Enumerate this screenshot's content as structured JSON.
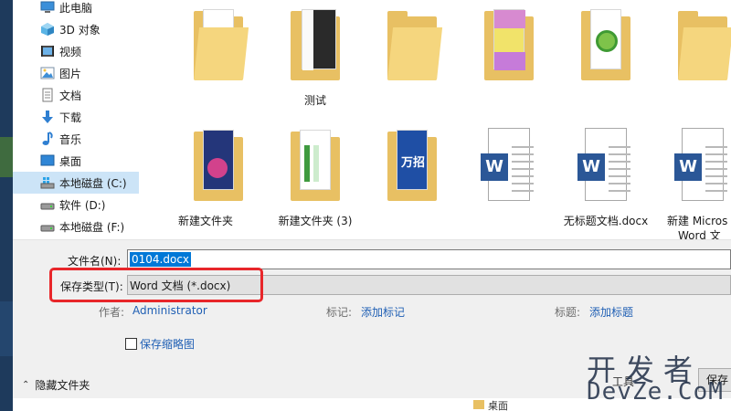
{
  "nav": {
    "items": [
      {
        "label": "此电脑",
        "icon": "computer-icon"
      },
      {
        "label": "3D 对象",
        "icon": "cube-3d-icon"
      },
      {
        "label": "视频",
        "icon": "video-icon"
      },
      {
        "label": "图片",
        "icon": "picture-icon"
      },
      {
        "label": "文档",
        "icon": "document-icon"
      },
      {
        "label": "下载",
        "icon": "download-arrow-icon"
      },
      {
        "label": "音乐",
        "icon": "music-note-icon"
      },
      {
        "label": "桌面",
        "icon": "desktop-icon"
      },
      {
        "label": "本地磁盘 (C:)",
        "icon": "windows-drive-icon",
        "selected": true
      },
      {
        "label": "软件 (D:)",
        "icon": "drive-icon"
      },
      {
        "label": "本地磁盘 (F:)",
        "icon": "drive-icon"
      }
    ]
  },
  "files": {
    "items": [
      {
        "name": "",
        "kind": "folder",
        "thumb": "code"
      },
      {
        "name": "测试",
        "kind": "folder",
        "thumb": "dark"
      },
      {
        "name": "",
        "kind": "folder",
        "thumb": "plain"
      },
      {
        "name": "",
        "kind": "folder",
        "thumb": "yellow-doc"
      },
      {
        "name": "",
        "kind": "folder",
        "thumb": "green-logo"
      },
      {
        "name": "",
        "kind": "folder",
        "thumb": "plain"
      },
      {
        "name": "新建文件夹",
        "kind": "folder",
        "thumb": "blue-book"
      },
      {
        "name": "新建文件夹 (3)",
        "kind": "folder",
        "thumb": "sheet"
      },
      {
        "name": "",
        "kind": "folder",
        "thumb": "blue-poster"
      },
      {
        "name": "",
        "kind": "word",
        "thumb": "word"
      },
      {
        "name": "无标题文档.docx",
        "kind": "word",
        "thumb": "word"
      },
      {
        "name": "新建 Micros",
        "name2": "Word 文",
        "kind": "word",
        "thumb": "word"
      }
    ]
  },
  "form": {
    "filename_label": "文件名(N):",
    "filename_value": "0104.docx",
    "filetype_label": "保存类型(T):",
    "filetype_value": "Word 文档 (*.docx)",
    "author_label": "作者:",
    "author_value": "Administrator",
    "tags_label": "标记:",
    "tags_value": "添加标记",
    "title_label": "标题:",
    "title_value": "添加标题",
    "thumbnail_label": "保存缩略图",
    "hide_folders_label": "隐藏文件夹",
    "tools_label": "工具",
    "save_label": "保存"
  },
  "strip": {
    "label": "桌面"
  },
  "watermark": {
    "cn": "开发者",
    "en": "DevZe.CoM"
  },
  "colors": {
    "accent": "#0078d7",
    "highlight": "#e8262a",
    "link": "#1f5fb4",
    "word": "#2b5797",
    "folder": "#e8c063"
  }
}
